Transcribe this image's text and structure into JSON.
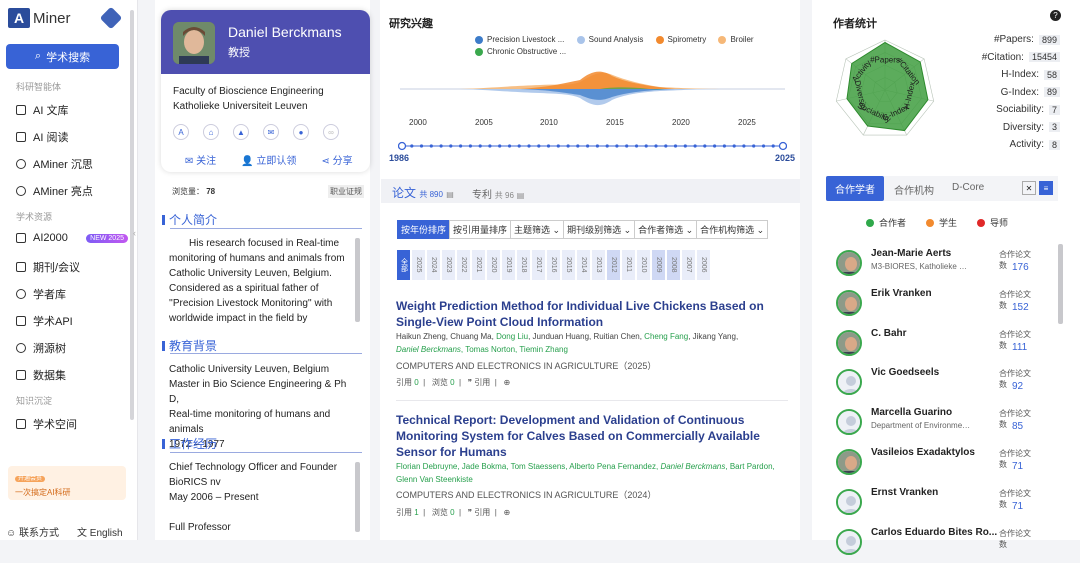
{
  "sidebar": {
    "logo_text": "Miner",
    "search_label": "学术搜索",
    "section1": "科研智能体",
    "items1": [
      {
        "label": "AI 文库"
      },
      {
        "label": "AI 阅读"
      },
      {
        "label": "AMiner 沉思"
      },
      {
        "label": "AMiner 亮点"
      }
    ],
    "section2": "学术资源",
    "items2": [
      {
        "label": "AI2000",
        "badge": "NEW 2025"
      },
      {
        "label": "期刊/会议"
      },
      {
        "label": "学者库"
      },
      {
        "label": "学术API"
      },
      {
        "label": "溯源树"
      },
      {
        "label": "数据集"
      }
    ],
    "section3": "知识沉淀",
    "items3": [
      {
        "label": "学术空间"
      }
    ],
    "promo_tag": "开通会员",
    "promo_text": "一次搞定AI科研",
    "footer_contact": "联系方式",
    "footer_lang": "English"
  },
  "profile": {
    "name": "Daniel Berckmans",
    "title": "教授",
    "affiliation_1": "Faculty of Bioscience Engineering",
    "affiliation_2": "Katholieke Universiteit Leuven",
    "follow": "关注",
    "claim": "立即认领",
    "share": "分享",
    "views_label": "浏览量：",
    "views_value": "78",
    "career_tag": "职业证规"
  },
  "bio": {
    "title": "个人简介",
    "text": "His research focused in Real-time monitoring of humans and animals from Catholic University Leuven, Belgium. Considered as a spiritual father of ''Precision Livestock Monitoring'' with worldwide impact in the field by"
  },
  "education": {
    "title": "教育背景",
    "lines": [
      "Catholic University Leuven, Belgium",
      "Master in Bio Science Engineering & Ph D,",
      "Real-time monitoring of humans and animals",
      "1972 – 1977"
    ]
  },
  "work": {
    "title": "工作经历",
    "lines": [
      "Chief Technology Officer and Founder",
      "BioRICS nv",
      "May 2006 – Present",
      "",
      "Full Professor"
    ]
  },
  "interests": {
    "title": "研究兴趣",
    "legend": [
      {
        "name": "Precision Livestock ...",
        "color": "#3d7cc9"
      },
      {
        "name": "Sound Analysis",
        "color": "#a9c4ea"
      },
      {
        "name": "Spirometry",
        "color": "#f28a2e"
      },
      {
        "name": "Broiler",
        "color": "#f6b878"
      },
      {
        "name": "Chronic Obstructive ...",
        "color": "#3aa84d"
      }
    ],
    "years": [
      "2000",
      "2005",
      "2010",
      "2015",
      "2020",
      "2025"
    ],
    "range_start": "1986",
    "range_end": "2025"
  },
  "papers": {
    "tab_papers": "论文",
    "tab_papers_count": "共 890",
    "tab_patents": "专利",
    "tab_patents_count": "共 96",
    "filters": [
      "按年份排序",
      "按引用量排序",
      "主题筛选 ⌄",
      "期刊级别筛选 ⌄",
      "合作者筛选 ⌄",
      "合作机构筛选 ⌄"
    ],
    "year_all": "全部",
    "year_list": [
      "2025",
      "2024",
      "2023",
      "2022",
      "2021",
      "2020",
      "2019",
      "2018",
      "2017",
      "2016",
      "2015",
      "2014",
      "2013",
      "2012",
      "2011",
      "2010",
      "2009",
      "2008",
      "2007",
      "2006"
    ],
    "list": [
      {
        "title": "Weight Prediction Method for Individual Live Chickens Based on Single-View Point Cloud Information",
        "authors_plain": "Haikun Zheng,  Chuang Ma,  ",
        "authors_green1": "Dong Liu",
        "authors_mid": ",  Junduan Huang,  Ruitian Chen,  ",
        "authors_green2": "Cheng Fang",
        "authors_end": ",  Jikang Yang,",
        "authors_line2_italic": "Daniel Berckmans",
        "authors_line2_rest": ",  Tomas Norton,  Tiemin Zhang",
        "venue": "COMPUTERS AND ELECTRONICS IN AGRICULTURE（2025）",
        "cite_label": "引用",
        "cite": "0",
        "view_label": "浏览",
        "view": "0",
        "quote": "引用"
      },
      {
        "title": "Technical Report: Development and Validation of Continuous Monitoring System for Calves Based on Commercially Available Sensor for Humans",
        "authors_line1_a": "Florian Debruyne,  Jade Bokma,  Tom Staessens,  Alberto Pena Fernandez,  ",
        "authors_line1_it": "Daniel Berckmans",
        "authors_line1_b": ",  Bart Pardon,",
        "authors_line2": "Glenn Van Steenkiste",
        "venue": "COMPUTERS AND ELECTRONICS IN AGRICULTURE（2024）",
        "cite_label": "引用",
        "cite": "1",
        "view_label": "浏览",
        "view": "0",
        "quote": "引用"
      }
    ]
  },
  "stats": {
    "title": "作者统计",
    "help": "?",
    "radar_labels": [
      "#Papers",
      "#Citation",
      "H-Index",
      "G-Index",
      "Sociability",
      "Diversity",
      "Activity"
    ],
    "metrics": [
      {
        "label": "#Papers:",
        "value": "899"
      },
      {
        "label": "#Citation:",
        "value": "15454"
      },
      {
        "label": "H-Index:",
        "value": "58"
      },
      {
        "label": "G-Index:",
        "value": "89"
      },
      {
        "label": "Sociability:",
        "value": "7"
      },
      {
        "label": "Diversity:",
        "value": "3"
      },
      {
        "label": "Activity:",
        "value": "8"
      }
    ]
  },
  "coauthors": {
    "tabs": [
      "合作学者",
      "合作机构",
      "D-Core"
    ],
    "legend": [
      {
        "label": "合作者",
        "color": "#2fa84a"
      },
      {
        "label": "学生",
        "color": "#f28a2e"
      },
      {
        "label": "导师",
        "color": "#e02828"
      }
    ],
    "count_label": "合作论文数",
    "list": [
      {
        "name": "Jean-Marie Aerts",
        "aff": "M3-BIORES, Katholieke Unive...",
        "count": "176",
        "photo": true
      },
      {
        "name": "Erik Vranken",
        "aff": "",
        "count": "152",
        "photo": true
      },
      {
        "name": "C. Bahr",
        "aff": "",
        "count": "111",
        "photo": true
      },
      {
        "name": "Vic Goedseels",
        "aff": "",
        "count": "92",
        "photo": false
      },
      {
        "name": "Marcella Guarino",
        "aff": "Department of Environmental ...",
        "count": "85",
        "photo": false
      },
      {
        "name": "Vasileios Exadaktylos",
        "aff": "",
        "count": "71",
        "photo": true
      },
      {
        "name": "Ernst Vranken",
        "aff": "",
        "count": "71",
        "photo": false
      },
      {
        "name": "Carlos Eduardo Bites Ro...",
        "aff": "",
        "count": "",
        "photo": false
      }
    ]
  }
}
